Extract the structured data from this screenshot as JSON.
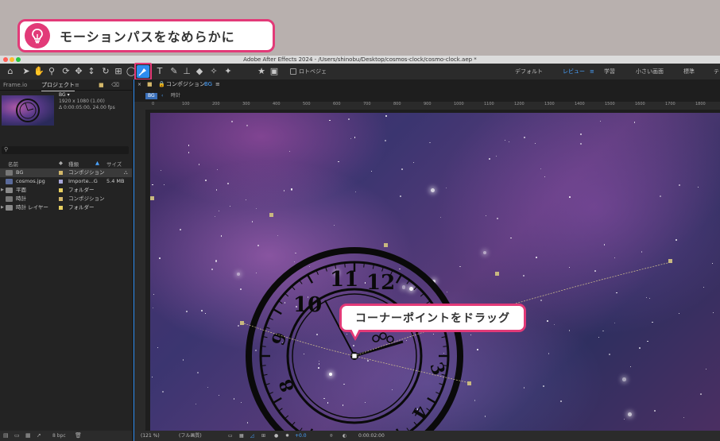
{
  "tip": {
    "text": "モーションパスをなめらかに",
    "icon": "lightbulb-icon"
  },
  "window": {
    "title": "Adobe After Effects 2024 - /Users/shinobu/Desktop/cosmos-clock/cosmo-clock.aep *"
  },
  "toolbar": {
    "rotobrush_label": "ロトベジェ",
    "workspaces": [
      "デフォルト",
      "レビュー",
      "学習",
      "小さい画面",
      "標準",
      "テ"
    ],
    "active_workspace": "レビュー"
  },
  "project_panel": {
    "tabs": [
      "Frame.io",
      "プロジェクト"
    ],
    "active_tab": "プロジェクト",
    "comp_name": "BG ▾",
    "comp_info_1": "1920 x 1080 (1.00)",
    "comp_info_2": "Δ 0:00:05:00, 24.00 fps",
    "columns": {
      "name": "名前",
      "type": "種類",
      "size": "サイズ"
    },
    "items": [
      {
        "name": "BG",
        "type": "コンポジション",
        "size": "",
        "selected": true,
        "swatch": "#d4b86a"
      },
      {
        "name": "cosmos.jpg",
        "type": "Importe...G",
        "size": "5.4 MB",
        "selected": false,
        "swatch": "#a6a6d8"
      },
      {
        "name": "平面",
        "type": "フォルダー",
        "size": "",
        "selected": false,
        "swatch": "#e8d060"
      },
      {
        "name": "時計",
        "type": "コンポジション",
        "size": "",
        "selected": false,
        "swatch": "#d4b86a"
      },
      {
        "name": "時計 レイヤー",
        "type": "フォルダー",
        "size": "",
        "selected": false,
        "swatch": "#e8d060"
      }
    ],
    "bpc": "8 bpc"
  },
  "viewer": {
    "panel_title": "コンポジション",
    "comp": "BG",
    "breadcrumb_root": "BG",
    "breadcrumb_child": "時計",
    "ruler_labels": [
      "0",
      "100",
      "200",
      "300",
      "400",
      "500",
      "600",
      "700",
      "800",
      "900",
      "1000",
      "1100",
      "1200",
      "1300",
      "1400",
      "1500",
      "1600",
      "1700",
      "1800",
      "1900"
    ],
    "zoom": "(121 %)",
    "resolution": "(フル画質)",
    "exposure": "+0.0",
    "timecode": "0:00:02:00",
    "clock_numbers": [
      "12",
      "11",
      "10",
      "2",
      "3",
      "4",
      "8",
      "9"
    ]
  },
  "callout": {
    "text": "コーナーポイントをドラッグ"
  },
  "colors": {
    "accent": "#e23a78",
    "selection": "#2d8cf0",
    "path": "#d8c890"
  }
}
